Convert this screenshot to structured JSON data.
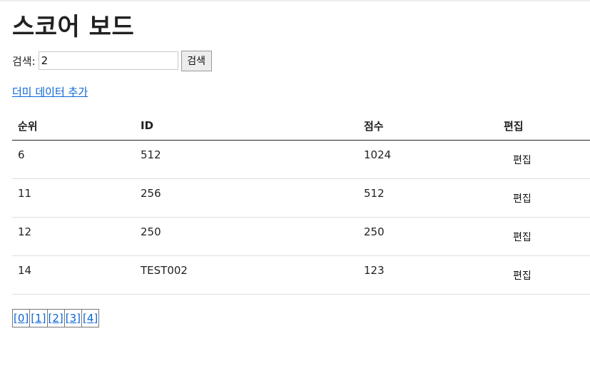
{
  "page": {
    "title": "스코어 보드"
  },
  "search": {
    "label": "검색:",
    "value": "2",
    "button_label": "검색"
  },
  "dummy_link": {
    "label": "더미 데이터 추가"
  },
  "table": {
    "headers": {
      "rank": "순위",
      "id": "ID",
      "score": "점수",
      "edit": "편집"
    },
    "rows": [
      {
        "rank": "6",
        "id": "512",
        "score": "1024",
        "edit_label": "편집"
      },
      {
        "rank": "11",
        "id": "256",
        "score": "512",
        "edit_label": "편집"
      },
      {
        "rank": "12",
        "id": "250",
        "score": "250",
        "edit_label": "편집"
      },
      {
        "rank": "14",
        "id": "TEST002",
        "score": "123",
        "edit_label": "편집"
      }
    ]
  },
  "pagination": {
    "pages": [
      "[0]",
      "[1]",
      "[2]",
      "[3]",
      "[4]"
    ]
  },
  "colors": {
    "link": "#0b66d6",
    "text": "#222222",
    "header_rule": "#222222",
    "row_rule": "#dddddd"
  }
}
